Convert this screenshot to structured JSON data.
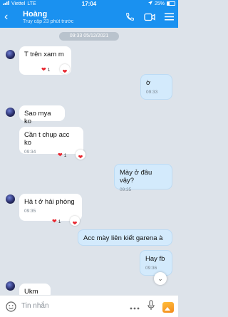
{
  "status_bar": {
    "carrier": "Viettel",
    "network": "LTE",
    "time": "17:04",
    "battery": "25%"
  },
  "header": {
    "title": "Hoàng",
    "subtitle": "Truy cập 23 phút trước"
  },
  "date_separator": "09:33 05/12/2021",
  "messages": [
    {
      "side": "in",
      "text": "T trên xam m",
      "reaction_count": "1"
    },
    {
      "side": "out",
      "text": "ờ",
      "time": "09:33"
    },
    {
      "side": "in",
      "text": "Sao mya ko"
    },
    {
      "side": "in",
      "text": "Cần t chụp acc ko",
      "time": "09:34",
      "reaction_count": "1"
    },
    {
      "side": "out",
      "text": "Mày ở đâu vậy?",
      "time": "09:35"
    },
    {
      "side": "in",
      "text": "Hả t ở hải phòng",
      "time": "09:35",
      "reaction_count": "1"
    },
    {
      "side": "out",
      "text": "Acc mày liên kiết garena à"
    },
    {
      "side": "out",
      "text": "Hay fb",
      "time": "09:36"
    },
    {
      "side": "in",
      "text": "Ukm"
    }
  ],
  "input": {
    "placeholder": "Tin nhắn"
  },
  "colors": {
    "header": "#1a91f0",
    "outgoing_bubble": "#d3eafc",
    "heart": "#e8262f"
  }
}
